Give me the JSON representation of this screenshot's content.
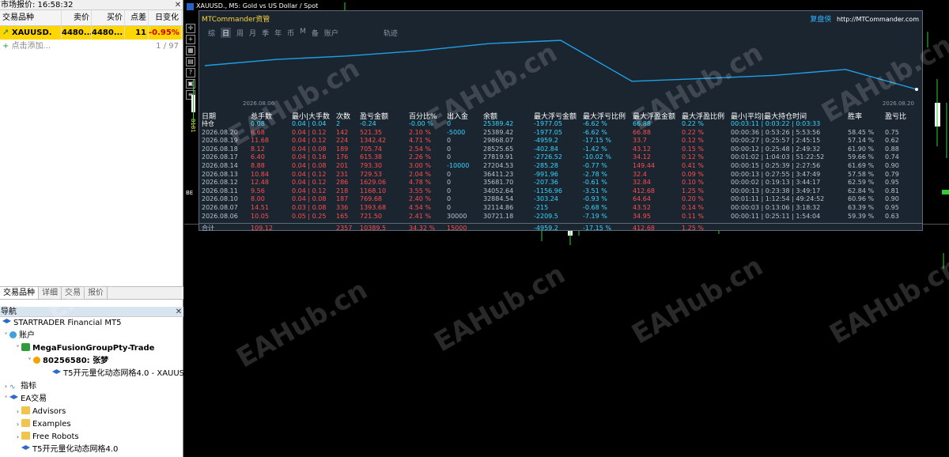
{
  "market_watch": {
    "title": "市场报价: 16:58:32",
    "columns": [
      "交易品种",
      "卖价",
      "买价",
      "点差",
      "日变化"
    ],
    "row": {
      "symbol": "XAUUSD.",
      "bid": "4480...",
      "ask": "4480...",
      "spread": "11",
      "change": "-0.95%"
    },
    "add_label": "点击添加...",
    "count": "1 / 97"
  },
  "bottom_tabs": [
    "交易品种",
    "详细",
    "交易",
    "报价"
  ],
  "navigator": {
    "title": "导航",
    "items": [
      {
        "label": "STARTRADER Financial MT5"
      },
      {
        "label": "账户"
      },
      {
        "label": "MegaFusionGroupPty-Trade"
      },
      {
        "label": "80256580: 张梦"
      },
      {
        "label": "T5开元量化动态网格4.0 - XAUUSD"
      },
      {
        "label": "指标"
      },
      {
        "label": "EA交易"
      },
      {
        "label": "Advisors"
      },
      {
        "label": "Examples"
      },
      {
        "label": "Free Robots"
      },
      {
        "label": "T5开元量化动态网格4.0"
      }
    ]
  },
  "chart_window": {
    "title": "XAUUSD., M5:  Gold vs US Dollar / Spot",
    "side_label": "8181",
    "edge_label": "BE"
  },
  "panel": {
    "brand": "MTCommander资管",
    "right_cn": "复盘侠",
    "right_url": "http://MTCommander.com",
    "tabs": [
      "综",
      "日",
      "周",
      "月",
      "季",
      "年",
      "币",
      "M",
      "备",
      "账户",
      "轨迹"
    ],
    "selected_tab": "日",
    "date_start": "2026.08.06",
    "date_end": "2026.08.20",
    "headers": [
      "日期",
      "总手数",
      "最小|大手数",
      "次数",
      "盈亏金额",
      "百分比%",
      "出入金",
      "余额",
      "最大浮亏金额",
      "最大浮亏比例",
      "最大浮盈金额",
      "最大浮盈比例",
      "最小|平均|最大持仓时间",
      "胜率",
      "盈亏比"
    ],
    "holding": [
      "持仓",
      "0.08",
      "0.04 | 0.04",
      "2",
      "-0.24",
      "-0.00 %",
      "0",
      "25389.42",
      "-1977.05",
      "-6.62 %",
      "66.88",
      "0.22 %",
      "00:03:11 | 0:03:22 | 0:03:33",
      "",
      ""
    ],
    "rows": [
      [
        "2026.08.20",
        "6.68",
        "0.04 | 0.12",
        "142",
        "521.35",
        "2.10 %",
        "-5000",
        "25389.42",
        "-1977.05",
        "-6.62 %",
        "66.88",
        "0.22 %",
        "00:00:36 | 0:53:26 | 5:53:56",
        "58.45 %",
        "0.75"
      ],
      [
        "2026.08.19",
        "11.68",
        "0.04 | 0.12",
        "224",
        "1342.42",
        "4.71 %",
        "0",
        "29868.07",
        "-4959.2",
        "-17.15 %",
        "33.7",
        "0.12 %",
        "00:00:27 | 0:25:57 | 2:45:15",
        "57.14 %",
        "0.62"
      ],
      [
        "2026.08.18",
        "8.12",
        "0.04 | 0.08",
        "189",
        "705.74",
        "2.54 %",
        "0",
        "28525.65",
        "-402.84",
        "-1.42 %",
        "43.12",
        "0.15 %",
        "00:00:12 | 0:25:48 | 2:49:32",
        "61.90 %",
        "0.88"
      ],
      [
        "2026.08.17",
        "6.40",
        "0.04 | 0.16",
        "176",
        "615.38",
        "2.26 %",
        "0",
        "27819.91",
        "-2726.52",
        "-10.02 %",
        "34.12",
        "0.12 %",
        "00:01:02 | 1:04:03 | 51:22:52",
        "59.66 %",
        "0.74"
      ],
      [
        "2026.08.14",
        "8.88",
        "0.04 | 0.08",
        "201",
        "793.30",
        "3.00 %",
        "-10000",
        "27204.53",
        "-285.28",
        "-0.77 %",
        "149.44",
        "0.41 %",
        "00:00:15 | 0:25:39 | 2:27:56",
        "61.69 %",
        "0.90"
      ],
      [
        "2026.08.13",
        "10.84",
        "0.04 | 0.12",
        "231",
        "729.53",
        "2.04 %",
        "0",
        "36411.23",
        "-991.96",
        "-2.78 %",
        "32.4",
        "0.09 %",
        "00:00:13 | 0:27:55 | 3:47:49",
        "57.58 %",
        "0.79"
      ],
      [
        "2026.08.12",
        "12.48",
        "0.04 | 0.12",
        "286",
        "1629.06",
        "4.78 %",
        "0",
        "35681.70",
        "-207.36",
        "-0.61 %",
        "32.84",
        "0.10 %",
        "00:00:02 | 0:19:13 | 3:44:17",
        "62.59 %",
        "0.95"
      ],
      [
        "2026.08.11",
        "9.56",
        "0.04 | 0.12",
        "218",
        "1168.10",
        "3.55 %",
        "0",
        "34052.64",
        "-1156.96",
        "-3.51 %",
        "412.68",
        "1.25 %",
        "00:00:13 | 0:23:38 | 3:49:17",
        "62.84 %",
        "0.81"
      ],
      [
        "2026.08.10",
        "8.00",
        "0.04 | 0.08",
        "187",
        "769.68",
        "2.40 %",
        "0",
        "32884.54",
        "-303.24",
        "-0.93 %",
        "64.64",
        "0.20 %",
        "00:01:11 | 1:12:54 | 49:24:52",
        "60.96 %",
        "0.90"
      ],
      [
        "2026.08.07",
        "14.51",
        "0.03 | 0.08",
        "336",
        "1393.68",
        "4.54 %",
        "0",
        "32114.86",
        "-215",
        "-0.68 %",
        "43.52",
        "0.14 %",
        "00:00:03 | 0:13:06 | 3:18:32",
        "63.39 %",
        "0.95"
      ],
      [
        "2026.08.06",
        "10.05",
        "0.05 | 0.25",
        "165",
        "721.50",
        "2.41 %",
        "30000",
        "30721.18",
        "-2209.5",
        "-7.19 %",
        "34.95",
        "0.11 %",
        "00:00:11 | 0:25:11 | 1:54:04",
        "59.39 %",
        "0.63"
      ]
    ],
    "total": [
      "合计",
      "109.12",
      "",
      "2357",
      "10389.5",
      "34.32 %",
      "15000",
      "",
      "-4959.2",
      "-17.15 %",
      "412.68",
      "1.25 %",
      "",
      "",
      ""
    ]
  },
  "watermark": "EAHub.cn",
  "colors": {
    "positive": "#ff4d4d",
    "negative": "#33d6ff",
    "curve": "#1ea0e6",
    "panel_bg": "#1b2530"
  }
}
